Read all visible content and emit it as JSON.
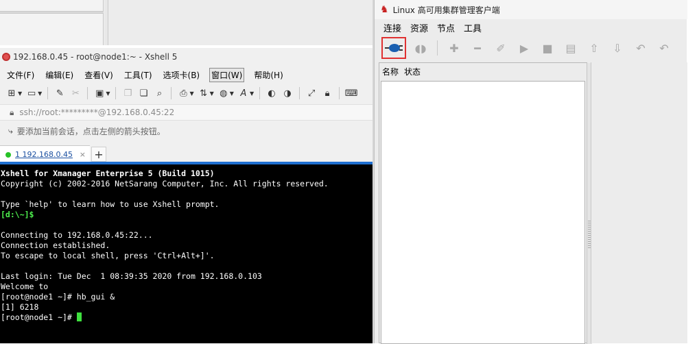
{
  "xshell": {
    "title": "192.168.0.45 - root@node1:~ - Xshell 5",
    "menu": [
      "文件(F)",
      "编辑(E)",
      "查看(V)",
      "工具(T)",
      "选项卡(B)",
      "窗口(W)",
      "帮助(H)"
    ],
    "address": "ssh://root:*********@192.168.0.45:22",
    "hint": "要添加当前会话，点击左侧的箭头按钮。",
    "tab_label": "1 192.168.0.45",
    "tab_close": "×",
    "tab_add": "+",
    "terminal": {
      "line1": "Xshell for Xmanager Enterprise 5 (Build 1015)",
      "line2": "Copyright (c) 2002-2016 NetSarang Computer, Inc. All rights reserved.",
      "line3": "Type `help' to learn how to use Xshell prompt.",
      "line4": "[d:\\~]$",
      "line5": "Connecting to 192.168.0.45:22...",
      "line6": "Connection established.",
      "line7": "To escape to local shell, press 'Ctrl+Alt+]'.",
      "line8": "Last login: Tue Dec  1 08:39:35 2020 from 192.168.0.103",
      "line9": "Welcome to",
      "line10": "[root@node1 ~]# hb_gui &",
      "line11": "[1] 6218",
      "line12": "[root@node1 ~]# "
    }
  },
  "hb": {
    "title": "Linux 高可用集群管理客户端",
    "menu": [
      "连接",
      "资源",
      "节点",
      "工具"
    ],
    "columns": [
      "名称",
      "状态"
    ]
  },
  "colors": {
    "terminal_bg": "#000000",
    "terminal_prompt": "#4ef04e",
    "tab_accent": "#1f6fd0",
    "highlight_border": "#e03030"
  }
}
